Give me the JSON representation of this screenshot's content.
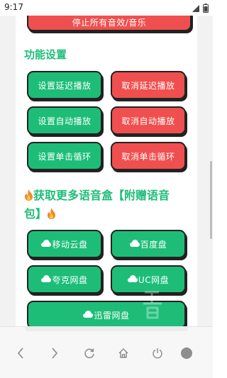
{
  "status_bar": {
    "time": "9:17"
  },
  "top_button": {
    "label": "停止所有音效/音乐"
  },
  "function_settings": {
    "title": "功能设置",
    "buttons": [
      {
        "label": "设置延迟播放"
      },
      {
        "label": "取消延迟播放"
      },
      {
        "label": "设置自动播放"
      },
      {
        "label": "取消自动播放"
      },
      {
        "label": "设置单击循环"
      },
      {
        "label": "取消单击循环"
      }
    ]
  },
  "more_voice_packs": {
    "title_line1": "获取更多语音盒【附赠语音",
    "title_line2": "包】",
    "disks": [
      {
        "label": "移动云盘"
      },
      {
        "label": "百度盘"
      },
      {
        "label": "夸克网盘"
      },
      {
        "label": "UC网盘"
      },
      {
        "label": "迅雷网盘"
      }
    ]
  },
  "colors": {
    "green": "#1dbd78",
    "red": "#f04f4f",
    "title_green": "#1dbd78"
  },
  "icons": [
    "signal-icon",
    "battery-icon",
    "fire-icon",
    "cloud-icon",
    "back-icon",
    "forward-icon",
    "refresh-icon",
    "home-icon",
    "power-icon",
    "menu-dot-icon"
  ]
}
